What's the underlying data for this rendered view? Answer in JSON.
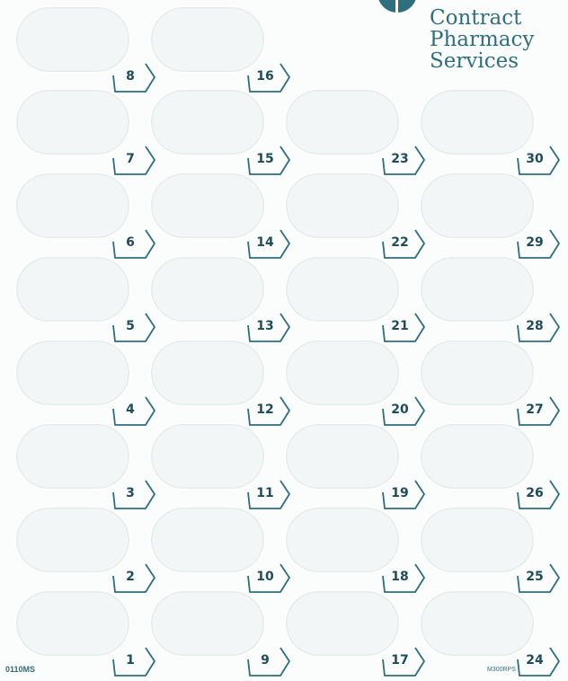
{
  "brand": {
    "lines": [
      "Contract",
      "Pharmacy",
      "Services"
    ],
    "accent_color": "#2d6f7d"
  },
  "left_code": "0110MS",
  "right_code": "M300RPS",
  "columns": [
    [
      8,
      7,
      6,
      5,
      4,
      3,
      2,
      1
    ],
    [
      16,
      15,
      14,
      13,
      12,
      11,
      10,
      9
    ],
    [
      null,
      23,
      22,
      21,
      20,
      19,
      18,
      17
    ],
    [
      null,
      30,
      29,
      28,
      27,
      26,
      25,
      24
    ]
  ]
}
